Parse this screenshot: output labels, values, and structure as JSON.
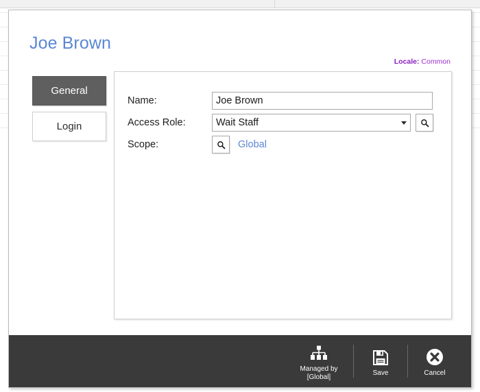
{
  "background": {
    "name": "underlying-list-page",
    "row_line_count": 9
  },
  "dialog": {
    "title": "Joe Brown",
    "locale": {
      "label": "Locale:",
      "value": "Common",
      "color": "#a12fd0"
    },
    "tabs": [
      {
        "id": "general",
        "label": "General",
        "selected": true
      },
      {
        "id": "login",
        "label": "Login",
        "selected": false
      }
    ],
    "form": {
      "name": {
        "label": "Name:",
        "value": "Joe Brown",
        "placeholder": ""
      },
      "access_role": {
        "label": "Access Role:",
        "value": "Wait Staff",
        "search_icon": "search-icon",
        "caret_icon": "chevron-down-icon"
      },
      "scope": {
        "label": "Scope:",
        "value": "Global",
        "search_icon": "search-icon",
        "link_color": "#5b87d4"
      }
    },
    "footer": {
      "buttons": [
        {
          "id": "managed-by",
          "label": "Managed by\n[Global]",
          "icon": "hierarchy-icon"
        },
        {
          "id": "save",
          "label": "Save",
          "icon": "floppy-disk-icon"
        },
        {
          "id": "cancel",
          "label": "Cancel",
          "icon": "close-circle-icon"
        }
      ]
    }
  },
  "colors": {
    "title": "#5b87d4",
    "locale": "#a12fd0",
    "tab_selected_bg": "#5f5f5f",
    "footer_bg": "#3a3a3a",
    "link": "#5b87d4"
  }
}
